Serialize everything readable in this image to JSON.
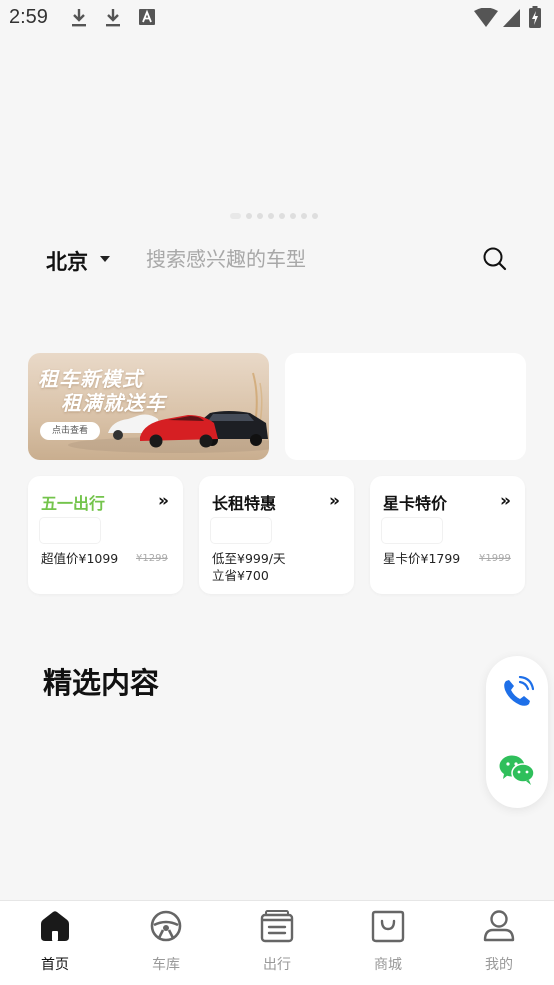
{
  "status_bar": {
    "time": "2:59"
  },
  "location": {
    "city": "北京"
  },
  "search": {
    "placeholder": "搜索感兴趣的车型"
  },
  "banner": {
    "dot_count": 8,
    "active_index": 0
  },
  "promo": {
    "line1": "租车新模式",
    "line2": "租满就送车",
    "button": "点击查看"
  },
  "deals": [
    {
      "title": "五一出行",
      "price_line1": "超值价¥1099",
      "price_line2": "",
      "old_price": "¥1299",
      "accent": "#74c44c"
    },
    {
      "title": "长租特惠",
      "price_line1": "低至¥999/天",
      "price_line2": "立省¥700",
      "old_price": "",
      "accent": "#111111"
    },
    {
      "title": "星卡特价",
      "price_line1": "星卡价¥1799",
      "price_line2": "",
      "old_price": "¥1999",
      "accent": "#111111"
    }
  ],
  "section": {
    "title": "精选内容"
  },
  "contact": {
    "phone_color": "#1e6fe8",
    "wechat_color": "#2fbf5b"
  },
  "nav": [
    {
      "label": "首页",
      "icon": "home-icon",
      "active": true
    },
    {
      "label": "车库",
      "icon": "steering-wheel-icon",
      "active": false
    },
    {
      "label": "出行",
      "icon": "list-box-icon",
      "active": false
    },
    {
      "label": "商城",
      "icon": "shopping-bag-icon",
      "active": false
    },
    {
      "label": "我的",
      "icon": "user-icon",
      "active": false
    }
  ]
}
